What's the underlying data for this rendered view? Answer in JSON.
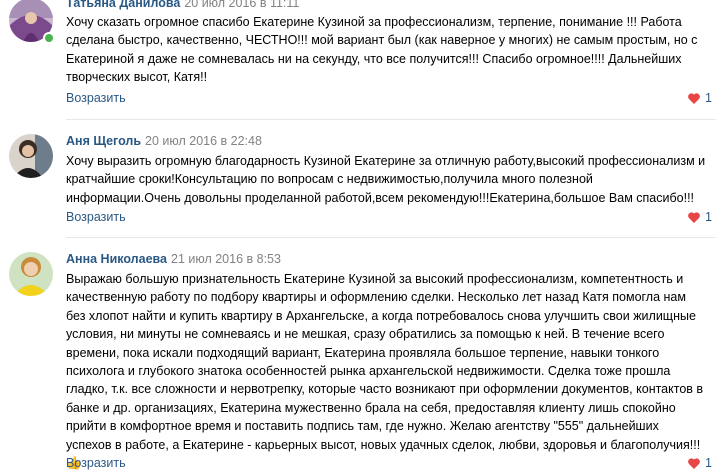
{
  "comments": [
    {
      "author": "Татьяна Данилова",
      "date": "20 июл 2016 в 11:11",
      "text": "Хочу сказать огромное спасибо Екатерине Кузиной за профессионализм, терпение, понимание !!! Работа сделана быстро, качественно, ЧЕСТНО!!! мой вариант был (как наверное у многих) не самым простым, но с Екатериной я даже не сомневалась ни на секунду, что все получится!!! Спасибо огромное!!!! Дальнейших творческих высот, Катя!!",
      "reply_label": "Возразить",
      "likes": "1"
    },
    {
      "author": "Аня Щеголь",
      "date": "20 июл 2016 в 22:48",
      "text": "Хочу выразить огромную благодарность Кузиной Екатерине за отличную работу,высокий профессионализм и кратчайшие сроки!Консультацию по вопросам с недвижимостью,получила много полезной информации.Очень довольны проделанной работой,всем рекомендую!!!Екатерина,большое Вам спасибо!!!",
      "reply_label": "Возразить",
      "likes": "1"
    },
    {
      "author": "Анна Николаева",
      "date": "21 июл 2016 в 8:53",
      "text": "Выражаю большую признательность Екатерине Кузиной за высокий профессионализм, компетентность и качественную работу по подбору квартиры и оформлению сделки. Несколько лет назад Катя помогла нам без хлопот найти и купить квартиру в Архангельске, а когда потребовалось снова улучшить свои жилищные условия, ни минуты не сомневаясь и не мешкая, сразу обратились за помощью к ней. В течение всего времени, пока искали подходящий вариант, Екатерина проявляла большое терпение, навыки тонкого психолога и глубокого знатока особенностей рынка архангельской недвижимости. Сделка тоже прошла гладко, т.к. все сложности и нервотрепку, которые часто возникают при оформлении документов, контактов в банке и др. организациях, Екатерина мужественно брала на себя, предоставляя клиенту лишь спокойно прийти в комфортное время и поставить подпись там, где нужно. Желаю агентству \"555\" дальнейших успехов в работе, а Екатерине - карьерных высот, новых удачных сделок, любви, здоровья и благополучия!!!👍",
      "reply_label": "Возразить",
      "likes": "1"
    }
  ],
  "colors": {
    "link": "#2a5885",
    "date": "#828282",
    "heart": "#e64646",
    "divider": "#e7e8ec"
  }
}
